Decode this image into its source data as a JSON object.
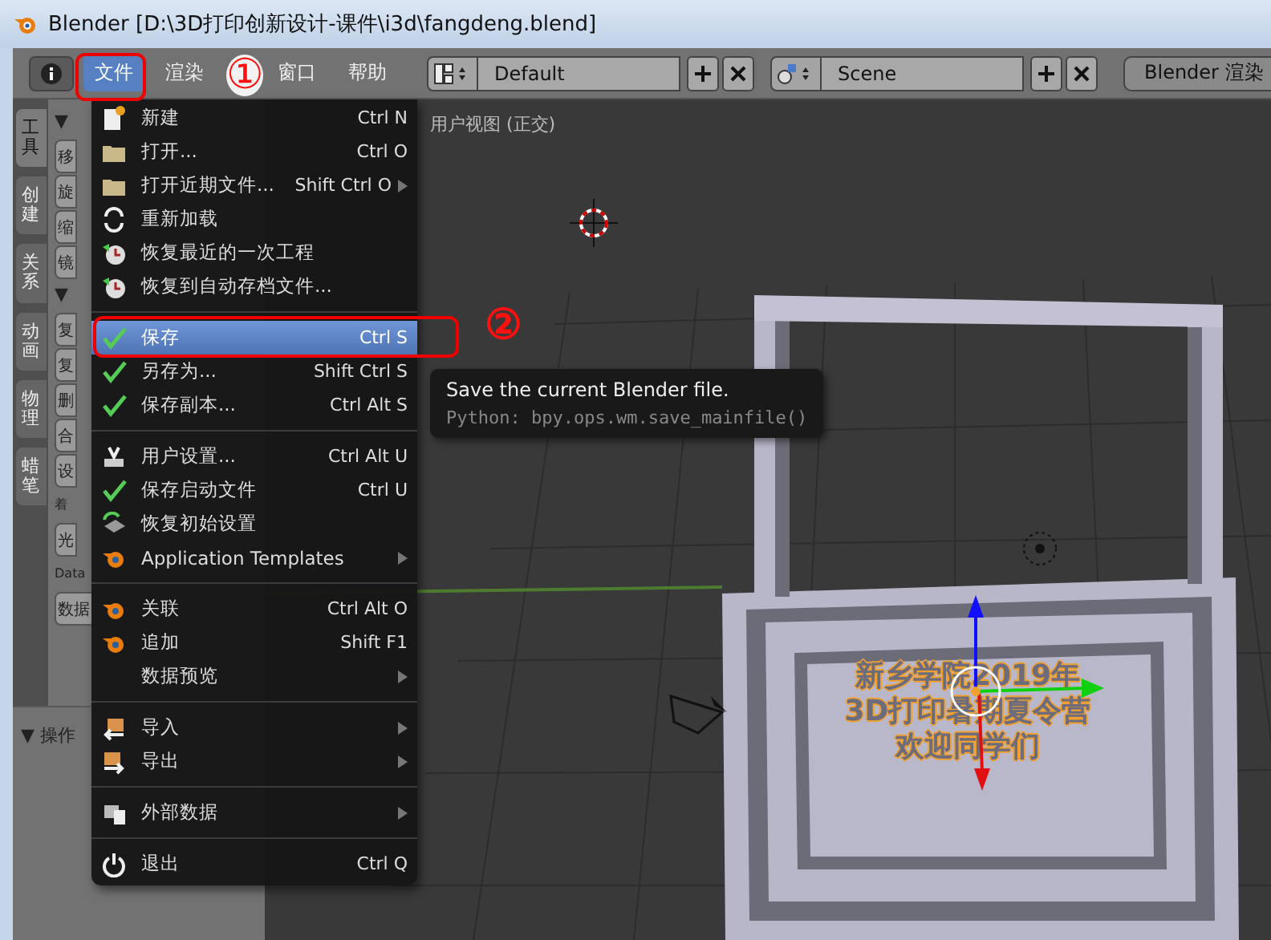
{
  "window": {
    "title": "Blender [D:\\3D打印创新设计-课件\\i3d\\fangdeng.blend]"
  },
  "header": {
    "menus": [
      {
        "label": "文件",
        "selected": true
      },
      {
        "label": "渲染",
        "selected": false
      },
      {
        "label": "窗口",
        "selected": false
      },
      {
        "label": "帮助",
        "selected": false
      }
    ],
    "layout": {
      "value": "Default"
    },
    "scene": {
      "value": "Scene"
    },
    "engine": {
      "value": "Blender 渲染"
    }
  },
  "tool_tabs": [
    {
      "label": "工具",
      "selected": true
    },
    {
      "label": "创建",
      "selected": false
    },
    {
      "label": "关系",
      "selected": false
    },
    {
      "label": "动画",
      "selected": false
    },
    {
      "label": "物理",
      "selected": false
    },
    {
      "label": "蜡笔",
      "selected": false
    }
  ],
  "tool_panel": {
    "sections": [
      {
        "header": "▼",
        "items": [
          {
            "kind": "button",
            "label": "移"
          },
          {
            "kind": "button",
            "label": "旋"
          },
          {
            "kind": "button",
            "label": "缩"
          },
          {
            "kind": "button",
            "label": "镜"
          }
        ]
      },
      {
        "header": "▼",
        "items": [
          {
            "kind": "button",
            "label": "复"
          },
          {
            "kind": "button",
            "label": "复"
          },
          {
            "kind": "button",
            "label": "删"
          },
          {
            "kind": "button",
            "label": "合"
          },
          {
            "kind": "button",
            "label": "设"
          },
          {
            "kind": "label",
            "label": "着"
          },
          {
            "kind": "button",
            "label": "光"
          },
          {
            "kind": "label",
            "label": "Data"
          },
          {
            "kind": "button",
            "label": "数据"
          }
        ]
      }
    ]
  },
  "operator_panel": {
    "title": "▼ 操作"
  },
  "viewport": {
    "view_label": "用户视图 (正交)",
    "scene_text": [
      "新乡学院2019年",
      "3D打印暑期夏令营",
      "欢迎同学们"
    ]
  },
  "file_menu": {
    "groups": [
      [
        {
          "label": "新建",
          "shortcut": "Ctrl N",
          "submenu": false,
          "selected": false
        },
        {
          "label": "打开...",
          "shortcut": "Ctrl O",
          "submenu": false,
          "selected": false
        },
        {
          "label": "打开近期文件...",
          "shortcut": "Shift Ctrl O",
          "submenu": true,
          "selected": false
        },
        {
          "label": "重新加载",
          "submenu": false,
          "selected": false
        },
        {
          "label": "恢复最近的一次工程",
          "submenu": false,
          "selected": false
        },
        {
          "label": "恢复到自动存档文件...",
          "submenu": false,
          "selected": false
        }
      ],
      [
        {
          "label": "保存",
          "shortcut": "Ctrl S",
          "submenu": false,
          "selected": true
        },
        {
          "label": "另存为...",
          "shortcut": "Shift Ctrl S",
          "submenu": false,
          "selected": false
        },
        {
          "label": "保存副本...",
          "shortcut": "Ctrl Alt S",
          "submenu": false,
          "selected": false
        }
      ],
      [
        {
          "label": "用户设置...",
          "shortcut": "Ctrl Alt U",
          "submenu": false,
          "selected": false
        },
        {
          "label": "保存启动文件",
          "shortcut": "Ctrl U",
          "submenu": false,
          "selected": false
        },
        {
          "label": "恢复初始设置",
          "submenu": false,
          "selected": false
        },
        {
          "label": "Application Templates",
          "submenu": true,
          "selected": false
        }
      ],
      [
        {
          "label": "关联",
          "shortcut": "Ctrl Alt O",
          "submenu": false,
          "selected": false
        },
        {
          "label": "追加",
          "shortcut": "Shift F1",
          "submenu": false,
          "selected": false
        },
        {
          "label": "数据预览",
          "submenu": true,
          "selected": false
        }
      ],
      [
        {
          "label": "导入",
          "submenu": true,
          "selected": false
        },
        {
          "label": "导出",
          "submenu": true,
          "selected": false
        }
      ],
      [
        {
          "label": "外部数据",
          "submenu": true,
          "selected": false
        }
      ],
      [
        {
          "label": "退出",
          "shortcut": "Ctrl Q",
          "submenu": false,
          "selected": false
        }
      ]
    ]
  },
  "tooltip": {
    "title": "Save the current Blender file.",
    "python": "Python: bpy.ops.wm.save_mainfile()"
  },
  "annotations": [
    {
      "label": "①"
    },
    {
      "label": "②"
    }
  ]
}
